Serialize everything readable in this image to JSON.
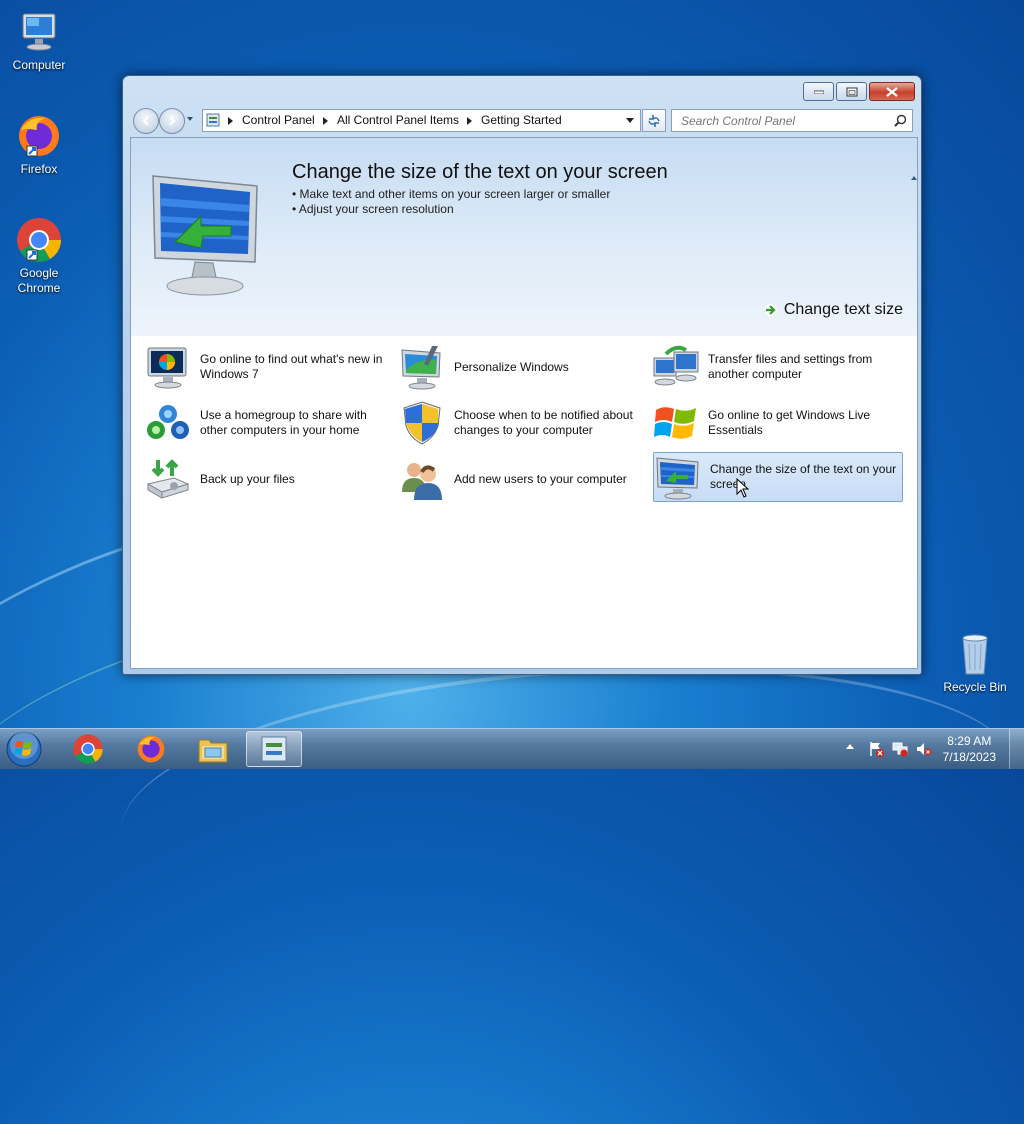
{
  "desktop": {
    "icons": [
      {
        "label": "Computer"
      },
      {
        "label": "Firefox"
      },
      {
        "label": "Google Chrome"
      },
      {
        "label": "Recycle Bin"
      }
    ]
  },
  "window": {
    "breadcrumbs": [
      "Control Panel",
      "All Control Panel Items",
      "Getting Started"
    ],
    "search_placeholder": "Search Control Panel",
    "banner": {
      "title": "Change the size of the text on your screen",
      "bullets": [
        "Make text and other items on your screen larger or smaller",
        "Adjust your screen resolution"
      ],
      "action_label": "Change text size"
    },
    "tasks": [
      {
        "label": "Go online to find out what's new in Windows 7",
        "icon": "whats-new-icon"
      },
      {
        "label": "Personalize Windows",
        "icon": "personalize-icon"
      },
      {
        "label": "Transfer files and settings from another computer",
        "icon": "easy-transfer-icon"
      },
      {
        "label": "Use a homegroup to share with other computers in your home",
        "icon": "homegroup-icon"
      },
      {
        "label": "Choose when to be notified about changes to your computer",
        "icon": "uac-shield-icon"
      },
      {
        "label": "Go online to get Windows Live Essentials",
        "icon": "windows-live-icon"
      },
      {
        "label": "Back up your files",
        "icon": "backup-icon"
      },
      {
        "label": "Add new users to your computer",
        "icon": "users-icon"
      },
      {
        "label": "Change the size of the text on your screen",
        "icon": "display-icon",
        "selected": true
      }
    ]
  },
  "taskbar": {
    "apps": [
      "chrome-icon",
      "firefox-icon",
      "explorer-icon",
      "control-panel-icon"
    ],
    "active_app": "control-panel-icon",
    "clock": {
      "time": "8:29 AM",
      "date": "7/18/2023"
    }
  }
}
